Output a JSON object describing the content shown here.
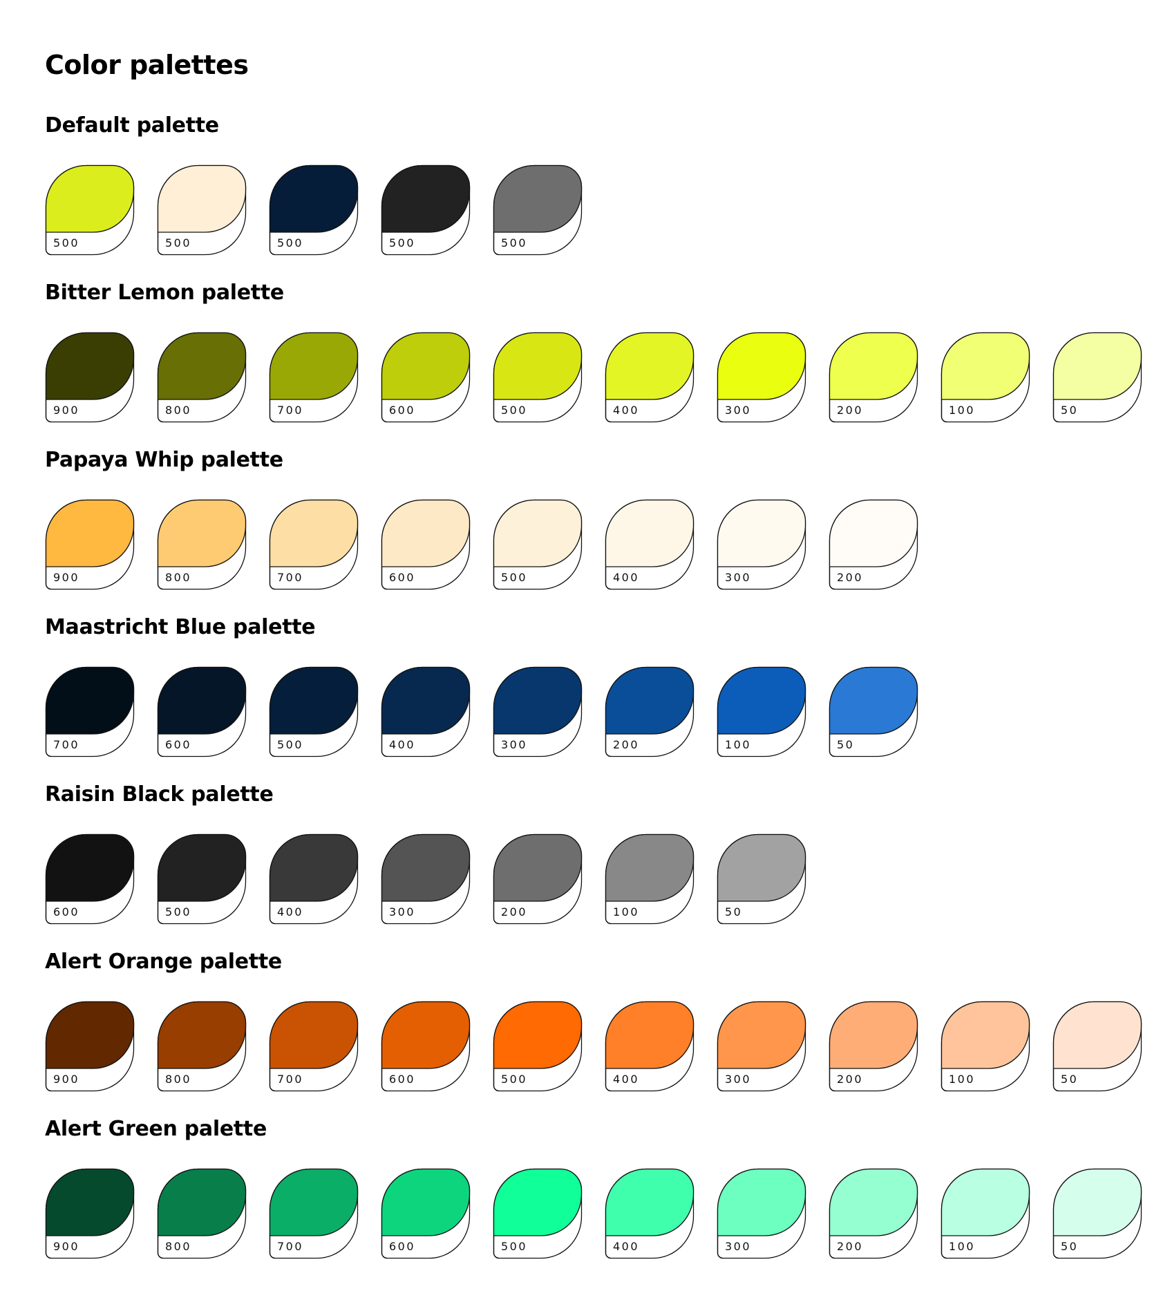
{
  "title": "Color palettes",
  "palettes": [
    {
      "name": "Default palette",
      "swatches": [
        {
          "label": "500",
          "color": "#DCED1D"
        },
        {
          "label": "500",
          "color": "#FFEFD6"
        },
        {
          "label": "500",
          "color": "#051D38"
        },
        {
          "label": "500",
          "color": "#222222"
        },
        {
          "label": "500",
          "color": "#6E6E6E"
        }
      ]
    },
    {
      "name": "Bitter Lemon palette",
      "swatches": [
        {
          "label": "900",
          "color": "#3B3E03"
        },
        {
          "label": "800",
          "color": "#676F05"
        },
        {
          "label": "700",
          "color": "#9AA805"
        },
        {
          "label": "600",
          "color": "#BECE0A"
        },
        {
          "label": "500",
          "color": "#D8E714"
        },
        {
          "label": "400",
          "color": "#E4F526"
        },
        {
          "label": "300",
          "color": "#EAFF10"
        },
        {
          "label": "200",
          "color": "#EFFF4E"
        },
        {
          "label": "100",
          "color": "#F1FF75"
        },
        {
          "label": "50",
          "color": "#F4FFA4"
        }
      ]
    },
    {
      "name": "Papaya Whip palette",
      "swatches": [
        {
          "label": "900",
          "color": "#FFB840"
        },
        {
          "label": "800",
          "color": "#FECB72"
        },
        {
          "label": "700",
          "color": "#FDDEA5"
        },
        {
          "label": "600",
          "color": "#FDE9C5"
        },
        {
          "label": "500",
          "color": "#FEF1D9"
        },
        {
          "label": "400",
          "color": "#FEF7E8"
        },
        {
          "label": "300",
          "color": "#FEFAF0"
        },
        {
          "label": "200",
          "color": "#FFFCF7"
        }
      ]
    },
    {
      "name": "Maastricht Blue palette",
      "swatches": [
        {
          "label": "700",
          "color": "#020F18"
        },
        {
          "label": "600",
          "color": "#041628"
        },
        {
          "label": "500",
          "color": "#051E3B"
        },
        {
          "label": "400",
          "color": "#07294F"
        },
        {
          "label": "300",
          "color": "#07376D"
        },
        {
          "label": "200",
          "color": "#0A4E9A"
        },
        {
          "label": "100",
          "color": "#0C5DB9"
        },
        {
          "label": "50",
          "color": "#2A79D4"
        }
      ]
    },
    {
      "name": "Raisin Black palette",
      "swatches": [
        {
          "label": "600",
          "color": "#121212"
        },
        {
          "label": "500",
          "color": "#222222"
        },
        {
          "label": "400",
          "color": "#393939"
        },
        {
          "label": "300",
          "color": "#545454"
        },
        {
          "label": "200",
          "color": "#6E6E6E"
        },
        {
          "label": "100",
          "color": "#888888"
        },
        {
          "label": "50",
          "color": "#A2A2A2"
        }
      ]
    },
    {
      "name": "Alert Orange palette",
      "swatches": [
        {
          "label": "900",
          "color": "#622800"
        },
        {
          "label": "800",
          "color": "#973E00"
        },
        {
          "label": "700",
          "color": "#C95302"
        },
        {
          "label": "600",
          "color": "#E45F02"
        },
        {
          "label": "500",
          "color": "#FF6A02"
        },
        {
          "label": "400",
          "color": "#FF8029"
        },
        {
          "label": "300",
          "color": "#FF964C"
        },
        {
          "label": "200",
          "color": "#FFAD77"
        },
        {
          "label": "100",
          "color": "#FFC49B"
        },
        {
          "label": "50",
          "color": "#FFE3D0"
        }
      ]
    },
    {
      "name": "Alert Green palette",
      "swatches": [
        {
          "label": "900",
          "color": "#064A2D"
        },
        {
          "label": "800",
          "color": "#087E4A"
        },
        {
          "label": "700",
          "color": "#0AAE66"
        },
        {
          "label": "600",
          "color": "#0DD57E"
        },
        {
          "label": "500",
          "color": "#10FF98"
        },
        {
          "label": "400",
          "color": "#40FFAC"
        },
        {
          "label": "300",
          "color": "#6CFFBF"
        },
        {
          "label": "200",
          "color": "#95FFD1"
        },
        {
          "label": "100",
          "color": "#B9FFE1"
        },
        {
          "label": "50",
          "color": "#D5FFEC"
        }
      ]
    }
  ]
}
